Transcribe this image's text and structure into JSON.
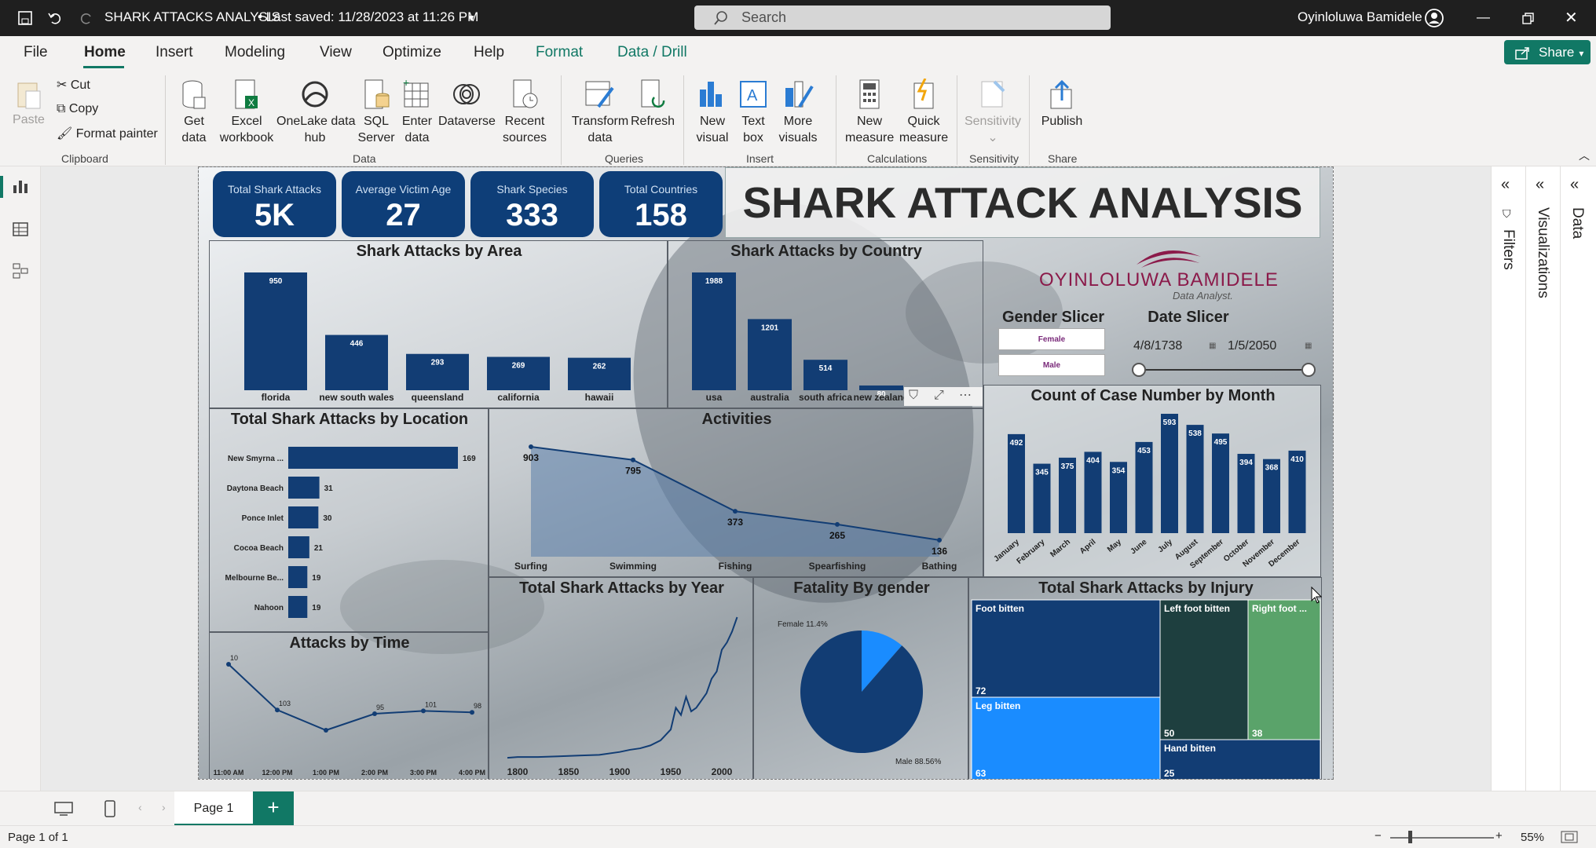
{
  "titlebar": {
    "title": "SHARK ATTACKS ANALYSIS",
    "saved": "• Last saved: 11/28/2023 at 11:26 PM",
    "search": "Search",
    "user": "Oyinloluwa Bamidele"
  },
  "menu": [
    "File",
    "Home",
    "Insert",
    "Modeling",
    "View",
    "Optimize",
    "Help",
    "Format",
    "Data / Drill"
  ],
  "share": "Share",
  "ribbon": {
    "paste": "Paste",
    "cut": "Cut",
    "copy": "Copy",
    "format_painter": "Format painter",
    "get_data": "Get\ndata",
    "excel": "Excel\nworkbook",
    "onelake": "OneLake data\nhub",
    "sql": "SQL\nServer",
    "enter_data": "Enter\ndata",
    "dataverse": "Dataverse",
    "recent": "Recent\nsources",
    "transform": "Transform\ndata",
    "refresh": "Refresh",
    "new_visual": "New\nvisual",
    "text_box": "Text\nbox",
    "more_visuals": "More\nvisuals",
    "new_measure": "New\nmeasure",
    "quick_measure": "Quick\nmeasure",
    "sensitivity": "Sensitivity",
    "publish": "Publish",
    "groups": [
      "Clipboard",
      "Data",
      "Queries",
      "Insert",
      "Calculations",
      "Sensitivity",
      "Share"
    ]
  },
  "kpis": [
    {
      "label": "Total Shark Attacks",
      "value": "5K"
    },
    {
      "label": "Average Victim Age",
      "value": "27"
    },
    {
      "label": "Shark Species",
      "value": "333"
    },
    {
      "label": "Total Countries",
      "value": "158"
    }
  ],
  "report_title": "SHARK ATTACK ANALYSIS",
  "logo": {
    "name": "OYINLOLUWA BAMIDELE",
    "sub": "Data Analyst."
  },
  "slicers": {
    "gender_title": "Gender Slicer",
    "gender_options": [
      "Female",
      "Male"
    ],
    "date_title": "Date Slicer",
    "date_start": "4/8/1738",
    "date_end": "1/5/2050"
  },
  "chart_data": [
    {
      "type": "bar",
      "title": "Shark Attacks by Area",
      "categories": [
        "florida",
        "new south wales",
        "queensland",
        "california",
        "hawaii"
      ],
      "values": [
        950,
        446,
        293,
        269,
        262
      ]
    },
    {
      "type": "bar",
      "title": "Shark Attacks by Country",
      "categories": [
        "usa",
        "australia",
        "south africa",
        "new zealand"
      ],
      "values": [
        1988,
        1201,
        514,
        80
      ]
    },
    {
      "type": "bar",
      "title": "Total Shark Attacks by Location",
      "orientation": "horizontal",
      "categories": [
        "New Smyrna ...",
        "Daytona Beach",
        "Ponce Inlet",
        "Cocoa Beach",
        "Melbourne Be...",
        "Nahoon"
      ],
      "values": [
        169,
        31,
        30,
        21,
        19,
        19
      ]
    },
    {
      "type": "area",
      "title": "Activities",
      "categories": [
        "Surfing",
        "Swimming",
        "Fishing",
        "Spearfishing",
        "Bathing"
      ],
      "values": [
        903,
        795,
        373,
        265,
        136
      ]
    },
    {
      "type": "bar",
      "title": "Count of Case Number by Month",
      "categories": [
        "January",
        "February",
        "March",
        "April",
        "May",
        "June",
        "July",
        "August",
        "September",
        "October",
        "November",
        "December"
      ],
      "values": [
        492,
        345,
        375,
        404,
        354,
        453,
        593,
        538,
        495,
        394,
        368,
        410
      ]
    },
    {
      "type": "line",
      "title": "Attacks by Time",
      "categories": [
        "11:00 AM",
        "12:00 PM",
        "1:00 PM",
        "2:00 PM",
        "3:00 PM",
        "4:00 PM"
      ],
      "values": [
        200,
        103,
        60,
        95,
        101,
        98
      ],
      "labels": [
        "10",
        "103",
        "",
        "95",
        "101",
        "98"
      ]
    },
    {
      "type": "line",
      "title": "Total Shark Attacks by Year",
      "x": [
        1790,
        1800,
        1820,
        1840,
        1860,
        1880,
        1900,
        1910,
        1920,
        1930,
        1940,
        1950,
        1955,
        1960,
        1965,
        1970,
        1975,
        1980,
        1985,
        1990,
        1995,
        2000,
        2005,
        2010,
        2015
      ],
      "values": [
        1,
        2,
        2,
        3,
        4,
        5,
        9,
        12,
        14,
        18,
        25,
        40,
        70,
        60,
        85,
        65,
        70,
        80,
        90,
        110,
        120,
        150,
        160,
        175,
        195
      ],
      "xticks": [
        "1800",
        "1850",
        "1900",
        "1950",
        "2000"
      ]
    },
    {
      "type": "pie",
      "title": "Fatality By gender",
      "categories": [
        "Female",
        "Male"
      ],
      "values": [
        11.4,
        88.56
      ],
      "labels": [
        "Female 11.4%",
        "Male 88.56%"
      ],
      "colors": [
        "#1a8cff",
        "#123d74"
      ]
    },
    {
      "type": "heatmap",
      "title": "Total Shark Attacks by Injury",
      "categories": [
        "Foot bitten",
        "Leg bitten",
        "Left foot bitten",
        "Right foot ...",
        "Hand bitten"
      ],
      "values": [
        72,
        63,
        50,
        38,
        25
      ]
    }
  ],
  "pages": {
    "tab": "Page 1",
    "status": "Page 1 of 1",
    "zoom": "55%"
  },
  "panes": {
    "filters": "Filters",
    "visualizations": "Visualizations",
    "data": "Data"
  }
}
